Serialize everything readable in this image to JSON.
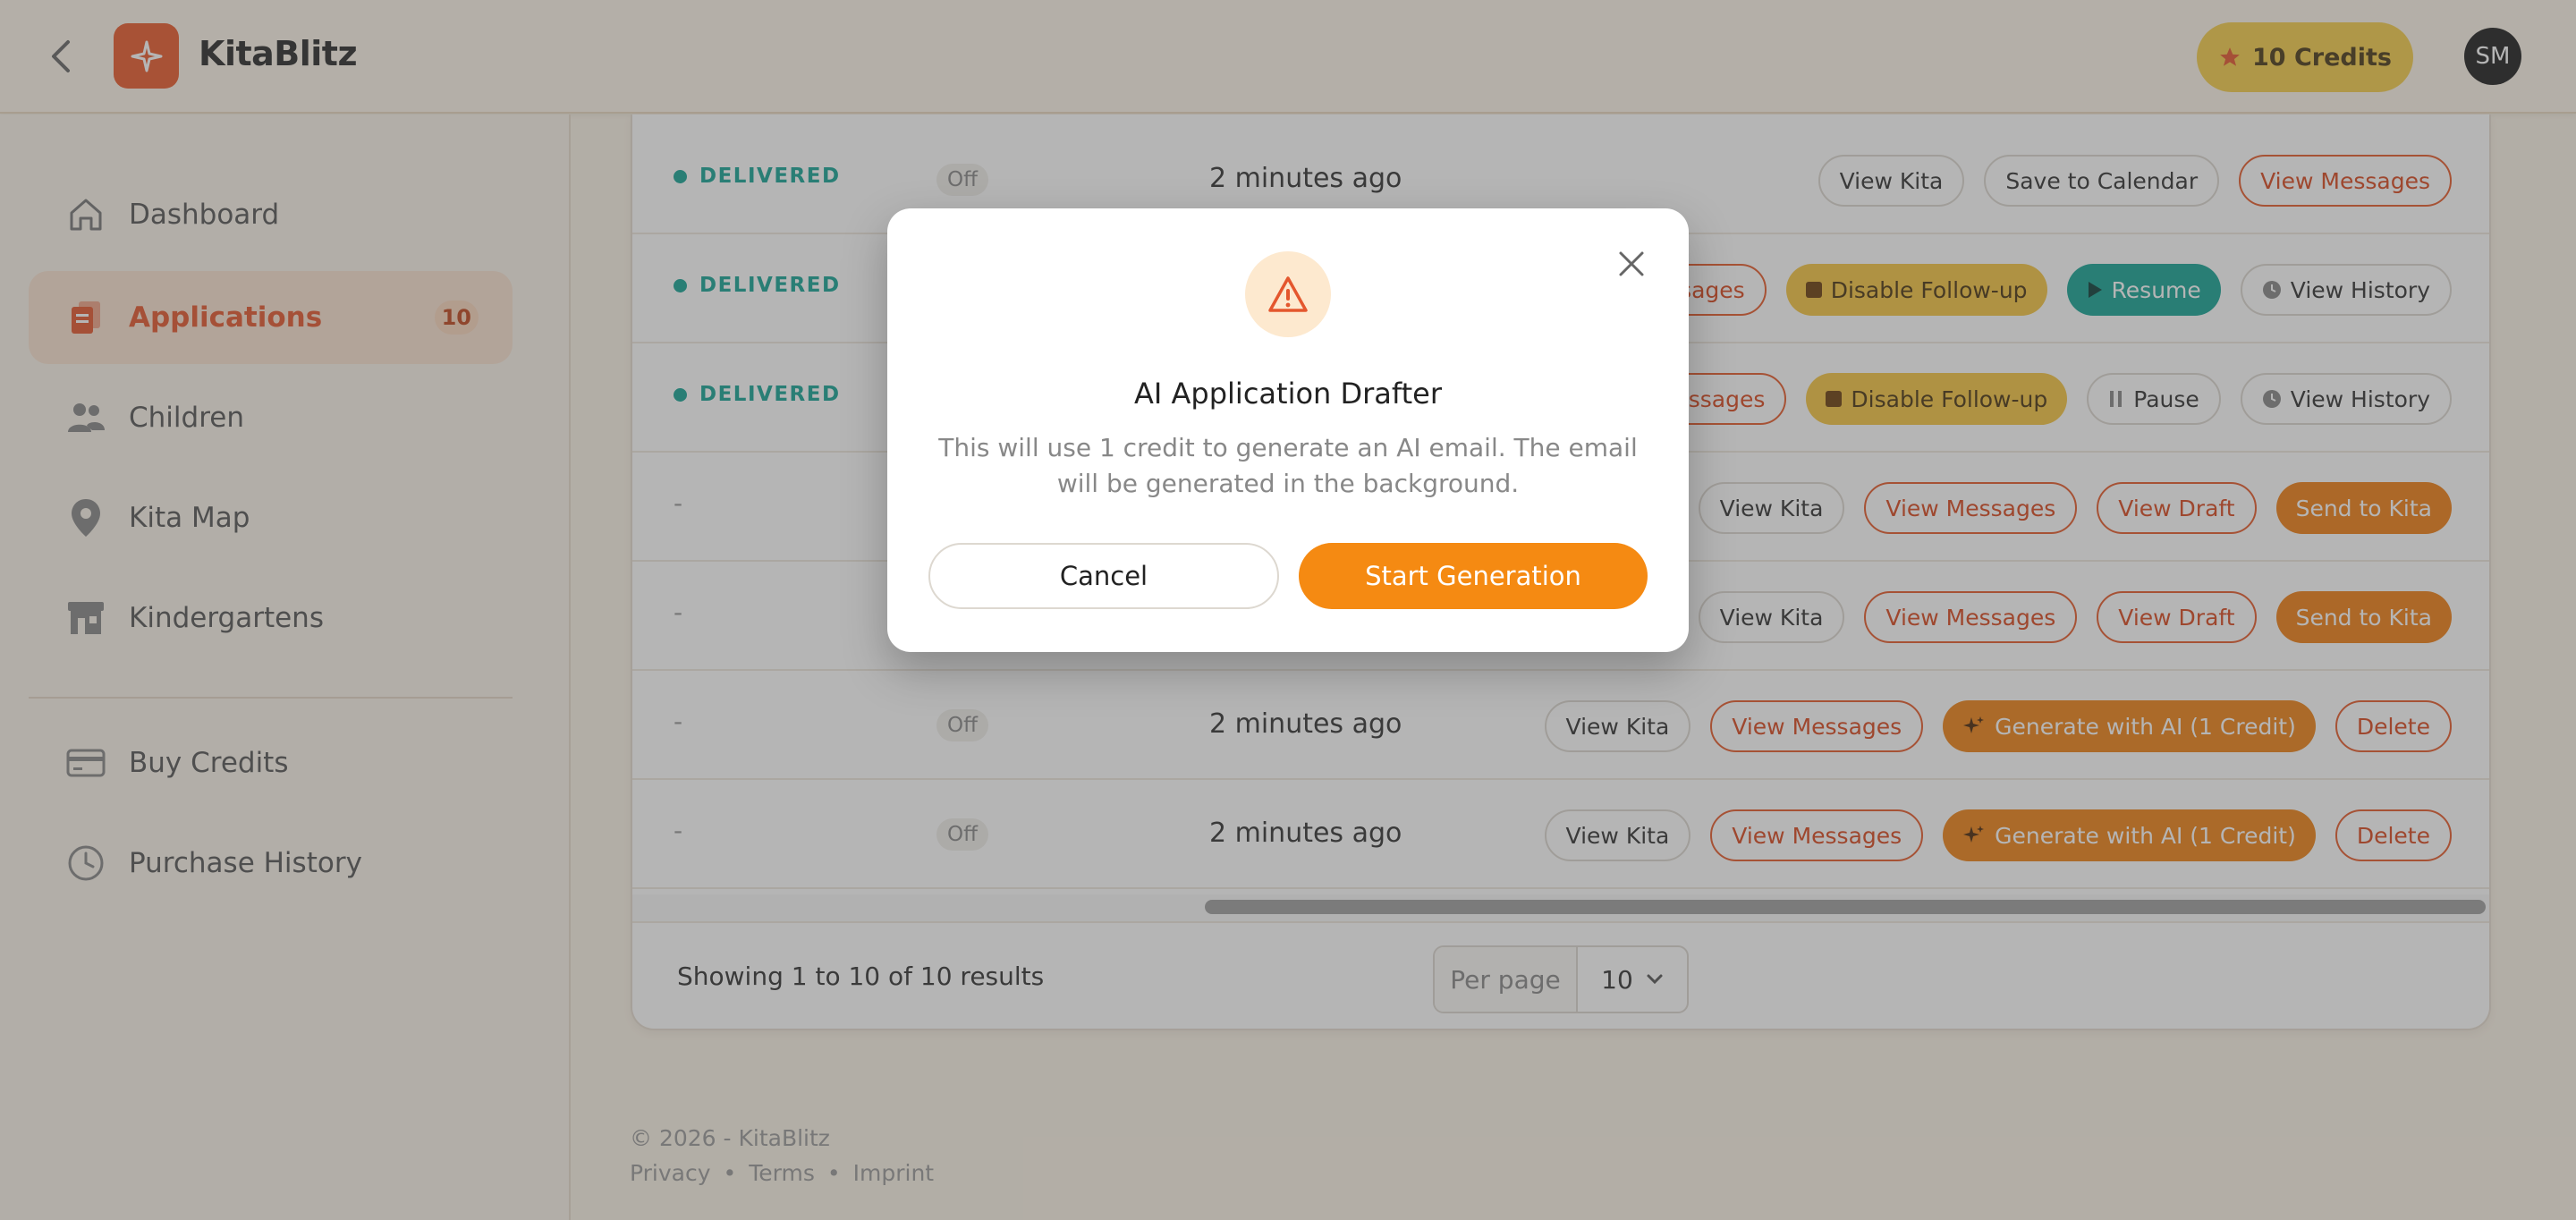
{
  "header": {
    "brand": "KitaBlitz",
    "credits_label": "10 Credits",
    "avatar_initials": "SM"
  },
  "sidebar": {
    "items": [
      {
        "label": "Dashboard"
      },
      {
        "label": "Applications",
        "badge": "10"
      },
      {
        "label": "Children"
      },
      {
        "label": "Kita Map"
      },
      {
        "label": "Kindergartens"
      },
      {
        "label": "Buy Credits"
      },
      {
        "label": "Purchase History"
      }
    ]
  },
  "table": {
    "rows": [
      {
        "status": "DELIVERED",
        "followup": "Off",
        "time": "2 minutes ago",
        "actions": [
          "View Kita",
          "Save to Calendar",
          "View Messages"
        ]
      },
      {
        "status": "DELIVERED",
        "actions": [
          "Messages",
          "Disable Follow-up",
          "Resume",
          "View History"
        ]
      },
      {
        "status": "DELIVERED",
        "actions": [
          "v Messages",
          "Disable Follow-up",
          "Pause",
          "View History"
        ]
      },
      {
        "status": "-",
        "actions": [
          "View Kita",
          "View Messages",
          "View Draft",
          "Send to Kita"
        ]
      },
      {
        "status": "-",
        "actions": [
          "View Kita",
          "View Messages",
          "View Draft",
          "Send to Kita"
        ]
      },
      {
        "status": "-",
        "followup": "Off",
        "time": "2 minutes ago",
        "actions": [
          "View Kita",
          "View Messages",
          "Generate with AI (1 Credit)",
          "Delete"
        ]
      },
      {
        "status": "-",
        "followup": "Off",
        "time": "2 minutes ago",
        "actions": [
          "View Kita",
          "View Messages",
          "Generate with AI (1 Credit)",
          "Delete"
        ]
      }
    ]
  },
  "pagination": {
    "results_text": "Showing 1 to 10 of 10 results",
    "per_page_label": "Per page",
    "per_page_value": "10"
  },
  "footer": {
    "copyright": "© 2026 - KitaBlitz",
    "links": [
      "Privacy",
      "•",
      "Terms",
      "•",
      "Imprint"
    ]
  },
  "modal": {
    "title": "AI Application Drafter",
    "text": "This will use 1 credit to generate an AI email. The email will be generated in the background.",
    "cancel_label": "Cancel",
    "confirm_label": "Start Generation"
  },
  "colors": {
    "brand": "#ea5a2c",
    "accent_orange": "#f58a12",
    "teal": "#16a394",
    "yellow": "#f5c542"
  }
}
